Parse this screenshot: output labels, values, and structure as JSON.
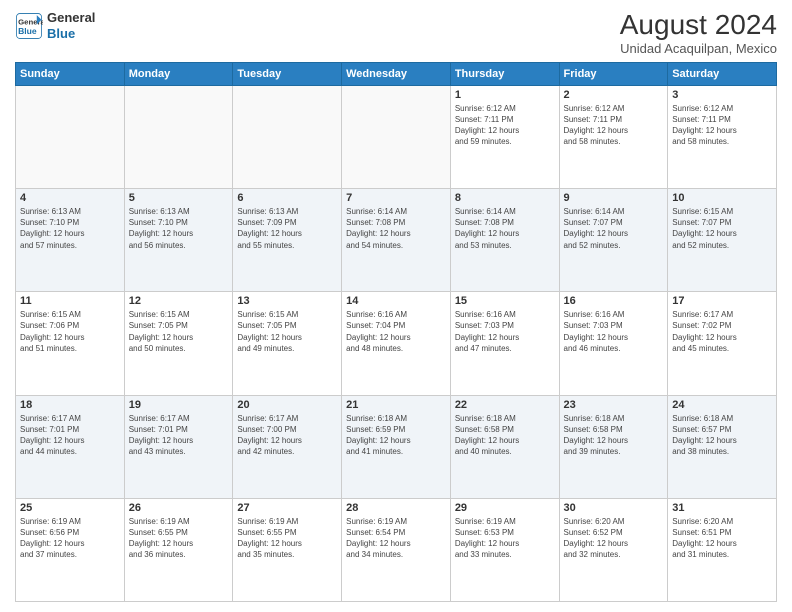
{
  "header": {
    "logo_line1": "General",
    "logo_line2": "Blue",
    "month_year": "August 2024",
    "location": "Unidad Acaquilpan, Mexico"
  },
  "weekdays": [
    "Sunday",
    "Monday",
    "Tuesday",
    "Wednesday",
    "Thursday",
    "Friday",
    "Saturday"
  ],
  "weeks": [
    [
      {
        "day": "",
        "info": ""
      },
      {
        "day": "",
        "info": ""
      },
      {
        "day": "",
        "info": ""
      },
      {
        "day": "",
        "info": ""
      },
      {
        "day": "1",
        "info": "Sunrise: 6:12 AM\nSunset: 7:11 PM\nDaylight: 12 hours\nand 59 minutes."
      },
      {
        "day": "2",
        "info": "Sunrise: 6:12 AM\nSunset: 7:11 PM\nDaylight: 12 hours\nand 58 minutes."
      },
      {
        "day": "3",
        "info": "Sunrise: 6:12 AM\nSunset: 7:11 PM\nDaylight: 12 hours\nand 58 minutes."
      }
    ],
    [
      {
        "day": "4",
        "info": "Sunrise: 6:13 AM\nSunset: 7:10 PM\nDaylight: 12 hours\nand 57 minutes."
      },
      {
        "day": "5",
        "info": "Sunrise: 6:13 AM\nSunset: 7:10 PM\nDaylight: 12 hours\nand 56 minutes."
      },
      {
        "day": "6",
        "info": "Sunrise: 6:13 AM\nSunset: 7:09 PM\nDaylight: 12 hours\nand 55 minutes."
      },
      {
        "day": "7",
        "info": "Sunrise: 6:14 AM\nSunset: 7:08 PM\nDaylight: 12 hours\nand 54 minutes."
      },
      {
        "day": "8",
        "info": "Sunrise: 6:14 AM\nSunset: 7:08 PM\nDaylight: 12 hours\nand 53 minutes."
      },
      {
        "day": "9",
        "info": "Sunrise: 6:14 AM\nSunset: 7:07 PM\nDaylight: 12 hours\nand 52 minutes."
      },
      {
        "day": "10",
        "info": "Sunrise: 6:15 AM\nSunset: 7:07 PM\nDaylight: 12 hours\nand 52 minutes."
      }
    ],
    [
      {
        "day": "11",
        "info": "Sunrise: 6:15 AM\nSunset: 7:06 PM\nDaylight: 12 hours\nand 51 minutes."
      },
      {
        "day": "12",
        "info": "Sunrise: 6:15 AM\nSunset: 7:05 PM\nDaylight: 12 hours\nand 50 minutes."
      },
      {
        "day": "13",
        "info": "Sunrise: 6:15 AM\nSunset: 7:05 PM\nDaylight: 12 hours\nand 49 minutes."
      },
      {
        "day": "14",
        "info": "Sunrise: 6:16 AM\nSunset: 7:04 PM\nDaylight: 12 hours\nand 48 minutes."
      },
      {
        "day": "15",
        "info": "Sunrise: 6:16 AM\nSunset: 7:03 PM\nDaylight: 12 hours\nand 47 minutes."
      },
      {
        "day": "16",
        "info": "Sunrise: 6:16 AM\nSunset: 7:03 PM\nDaylight: 12 hours\nand 46 minutes."
      },
      {
        "day": "17",
        "info": "Sunrise: 6:17 AM\nSunset: 7:02 PM\nDaylight: 12 hours\nand 45 minutes."
      }
    ],
    [
      {
        "day": "18",
        "info": "Sunrise: 6:17 AM\nSunset: 7:01 PM\nDaylight: 12 hours\nand 44 minutes."
      },
      {
        "day": "19",
        "info": "Sunrise: 6:17 AM\nSunset: 7:01 PM\nDaylight: 12 hours\nand 43 minutes."
      },
      {
        "day": "20",
        "info": "Sunrise: 6:17 AM\nSunset: 7:00 PM\nDaylight: 12 hours\nand 42 minutes."
      },
      {
        "day": "21",
        "info": "Sunrise: 6:18 AM\nSunset: 6:59 PM\nDaylight: 12 hours\nand 41 minutes."
      },
      {
        "day": "22",
        "info": "Sunrise: 6:18 AM\nSunset: 6:58 PM\nDaylight: 12 hours\nand 40 minutes."
      },
      {
        "day": "23",
        "info": "Sunrise: 6:18 AM\nSunset: 6:58 PM\nDaylight: 12 hours\nand 39 minutes."
      },
      {
        "day": "24",
        "info": "Sunrise: 6:18 AM\nSunset: 6:57 PM\nDaylight: 12 hours\nand 38 minutes."
      }
    ],
    [
      {
        "day": "25",
        "info": "Sunrise: 6:19 AM\nSunset: 6:56 PM\nDaylight: 12 hours\nand 37 minutes."
      },
      {
        "day": "26",
        "info": "Sunrise: 6:19 AM\nSunset: 6:55 PM\nDaylight: 12 hours\nand 36 minutes."
      },
      {
        "day": "27",
        "info": "Sunrise: 6:19 AM\nSunset: 6:55 PM\nDaylight: 12 hours\nand 35 minutes."
      },
      {
        "day": "28",
        "info": "Sunrise: 6:19 AM\nSunset: 6:54 PM\nDaylight: 12 hours\nand 34 minutes."
      },
      {
        "day": "29",
        "info": "Sunrise: 6:19 AM\nSunset: 6:53 PM\nDaylight: 12 hours\nand 33 minutes."
      },
      {
        "day": "30",
        "info": "Sunrise: 6:20 AM\nSunset: 6:52 PM\nDaylight: 12 hours\nand 32 minutes."
      },
      {
        "day": "31",
        "info": "Sunrise: 6:20 AM\nSunset: 6:51 PM\nDaylight: 12 hours\nand 31 minutes."
      }
    ]
  ]
}
